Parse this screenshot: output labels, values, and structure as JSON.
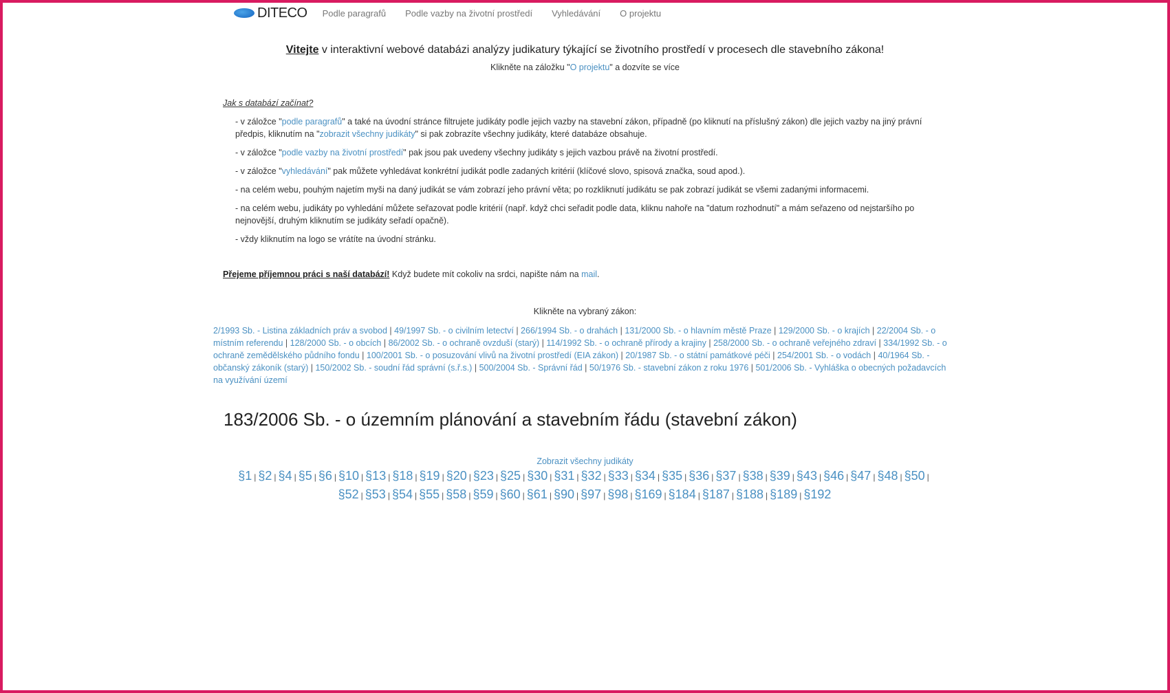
{
  "nav": {
    "logo": "DITECO",
    "items": [
      "Podle paragrafů",
      "Podle vazby na životní prostředí",
      "Vyhledávání",
      "O projektu"
    ]
  },
  "welcome": {
    "bold": "Vitejte",
    "rest": " v interaktivní webové databázi analýzy judikatury týkající se životního prostředí v procesech dle stavebního zákona!",
    "sub_before": "Klikněte na záložku \"",
    "sub_link": "O projektu",
    "sub_after": "\" a dozvíte se více"
  },
  "howto": {
    "title": "Jak s databází začínat?",
    "items": [
      {
        "parts": [
          "- v záložce \"",
          "podle paragrafů",
          "\" a také na úvodní stránce filtrujete judikáty podle jejich vazby na stavební zákon, případně (po kliknutí na příslušný zákon) dle jejich vazby na jiný právní předpis, kliknutím na \"",
          "zobrazit všechny judikáty",
          "\" si pak zobrazíte všechny judikáty, které databáze obsahuje."
        ]
      },
      {
        "parts": [
          "- v záložce \"",
          "podle vazby na životní prostředí",
          "\" pak jsou pak uvedeny všechny judikáty s jejich vazbou právě na životní prostředí."
        ]
      },
      {
        "parts": [
          "- v záložce \"",
          "vyhledávání",
          "\" pak můžete vyhledávat konkrétní judikát podle zadaných kritérií (klíčové slovo, spisová značka, soud apod.)."
        ]
      },
      {
        "parts": [
          "- na celém webu, pouhým najetím myši na daný judikát se vám zobrazí jeho právní věta; po rozkliknutí judikátu se pak zobrazí judikát se všemi zadanými informacemi."
        ]
      },
      {
        "parts": [
          "- na celém webu, judikáty po vyhledání můžete seřazovat podle kritérií (např. když chci seřadit podle data, kliknu nahoře na \"datum rozhodnutí\" a mám seřazeno od nejstaršího po nejnovější, druhým kliknutím se judikáty seřadí opačně)."
        ]
      },
      {
        "parts": [
          "- vždy kliknutím na logo se vrátíte na úvodní stránku."
        ]
      }
    ]
  },
  "greeting": {
    "bold": "Přejeme příjemnou práci s naší databází!",
    "rest": " Když budete mít cokoliv na srdci, napište nám na ",
    "link": "mail",
    "end": "."
  },
  "laws": {
    "title": "Klikněte na vybraný zákon:",
    "items": [
      "2/1993 Sb. - Listina základních práv a svobod",
      "49/1997 Sb. - o civilním letectví",
      "266/1994 Sb. - o drahách",
      "131/2000 Sb. - o hlavním městě Praze",
      "129/2000 Sb. - o krajích",
      "22/2004 Sb. - o místním referendu",
      "128/2000 Sb. - o obcích",
      "86/2002 Sb. - o ochraně ovzduší (starý)",
      "114/1992 Sb. - o ochraně přírody a krajiny",
      "258/2000 Sb. - o ochraně veřejného zdraví",
      "334/1992 Sb. - o ochraně zemědělského půdního fondu",
      "100/2001 Sb. - o posuzování vlivů na životní prostředí (EIA zákon)",
      "20/1987 Sb. - o státní památkové péči",
      "254/2001 Sb. - o vodách",
      "40/1964 Sb. - občanský zákoník (starý)",
      "150/2002 Sb. - soudní řád správní (s.ř.s.)",
      "500/2004 Sb. - Správní řád",
      "50/1976 Sb. - stavební zákon z roku 1976",
      "501/2006 Sb. - Vyhláška o obecných požadavcích na využívání území"
    ]
  },
  "law_heading": "183/2006 Sb. - o územním plánování a stavebním řádu (stavební zákon)",
  "show_all": "Zobrazit všechny judikáty",
  "paragraphs_row1": [
    "§1",
    "§2",
    "§4",
    "§5",
    "§6",
    "§10",
    "§13",
    "§18",
    "§19",
    "§20",
    "§23",
    "§25",
    "§30",
    "§31",
    "§32",
    "§33",
    "§34",
    "§35",
    "§36",
    "§37",
    "§38",
    "§39",
    "§43",
    "§46",
    "§47",
    "§48",
    "§50"
  ],
  "paragraphs_row2": [
    "§52",
    "§53",
    "§54",
    "§55",
    "§58",
    "§59",
    "§60",
    "§61",
    "§90",
    "§97",
    "§98",
    "§169",
    "§184",
    "§187",
    "§188",
    "§189",
    "§192"
  ]
}
